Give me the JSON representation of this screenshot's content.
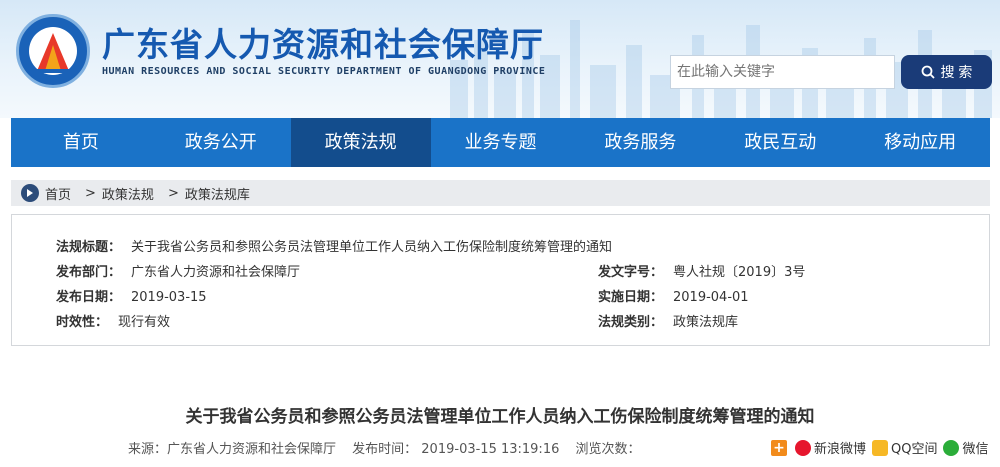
{
  "header": {
    "site_title": "广东省人力资源和社会保障厅",
    "site_subtitle": "HUMAN RESOURCES AND SOCIAL SECURITY DEPARTMENT OF GUANGDONG PROVINCE",
    "search_placeholder": "在此输入关键字",
    "search_button": "搜 索"
  },
  "nav": {
    "items": [
      {
        "label": "首页"
      },
      {
        "label": "政务公开"
      },
      {
        "label": "政策法规"
      },
      {
        "label": "业务专题"
      },
      {
        "label": "政务服务"
      },
      {
        "label": "政民互动"
      },
      {
        "label": "移动应用"
      }
    ],
    "active_index": 2
  },
  "breadcrumb": {
    "items": [
      "首页",
      "政策法规",
      "政策法规库"
    ],
    "separator": ">"
  },
  "info": {
    "title_label": "法规标题：",
    "title_value": "关于我省公务员和参照公务员法管理单位工作人员纳入工伤保险制度统筹管理的通知",
    "dept_label": "发布部门：",
    "dept_value": "广东省人力资源和社会保障厅",
    "doc_no_label": "发文字号：",
    "doc_no_value": "粤人社规〔2019〕3号",
    "pub_date_label": "发布日期：",
    "pub_date_value": "2019-03-15",
    "impl_date_label": "实施日期：",
    "impl_date_value": "2019-04-01",
    "validity_label": "时效性：",
    "validity_value": "现行有效",
    "category_label": "法规类别：",
    "category_value": "政策法规库"
  },
  "article": {
    "title": "关于我省公务员和参照公务员法管理单位工作人员纳入工伤保险制度统筹管理的通知",
    "source": "来源：广东省人力资源和社会保障厅",
    "pub_time": "发布时间： 2019-03-15 13:19:16",
    "views": "浏览次数："
  },
  "share": {
    "weibo": "新浪微博",
    "qzone": "QQ空间",
    "wechat": "微信"
  },
  "colors": {
    "nav_bg": "#1a73c8",
    "nav_active": "#134d8d",
    "title_blue": "#1559b0",
    "search_btn": "#1a3b78"
  }
}
